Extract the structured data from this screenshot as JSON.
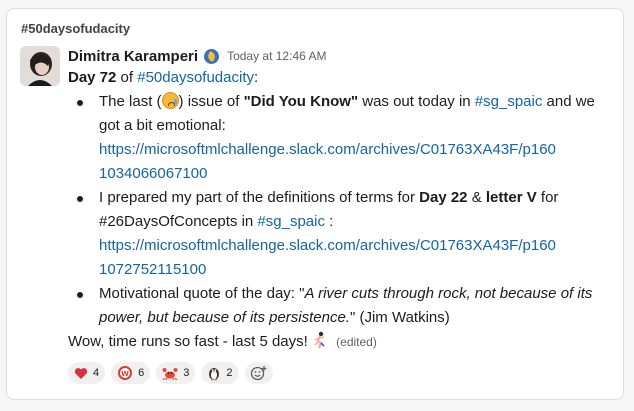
{
  "channel": {
    "name": "#50daysofudacity"
  },
  "message": {
    "author": "Dimitra Karamperi",
    "timestamp": "Today at 12:46 AM",
    "intro": {
      "day_label": "Day 72",
      "of": " of ",
      "hashtag": "#50daysofudacity",
      "colon": ":"
    },
    "bullets": [
      {
        "t1": "The last (",
        "t2": ") issue of ",
        "bold": "\"Did You Know\"",
        "t3": " was out today in ",
        "channel": "#sg_spaic",
        "t4": " and we got a bit emotional:",
        "url": "https://microsoftmlchallenge.slack.com/archives/C01763XA43F/p1601034066067100"
      },
      {
        "t1": "I prepared my part of the definitions of terms for ",
        "bold1": "Day 22",
        "t2": " & ",
        "bold2": "letter V",
        "t3": " for #26DaysOfConcepts in ",
        "channel": "#sg_spaic",
        "t4": " :",
        "url": "https://microsoftmlchallenge.slack.com/archives/C01763XA43F/p1601072752115100"
      },
      {
        "t1": "Motivational quote of the day: \"",
        "quote": "A river cuts through rock, not because of its power, but because of its persistence.",
        "t2": "\" (Jim Watkins)"
      }
    ],
    "closing": "Wow, time runs so fast - last 5 days!",
    "edited": "(edited)"
  },
  "reactions": [
    {
      "icon": "heart-icon",
      "count": "4",
      "color": "#dd2e44"
    },
    {
      "icon": "wow-badge-icon",
      "count": "6",
      "color": "#d93a3a"
    },
    {
      "icon": "crab-icon",
      "count": "3",
      "color": "#e8453c"
    },
    {
      "icon": "penguin-icon",
      "count": "2",
      "color": "#3a3a3a"
    }
  ]
}
